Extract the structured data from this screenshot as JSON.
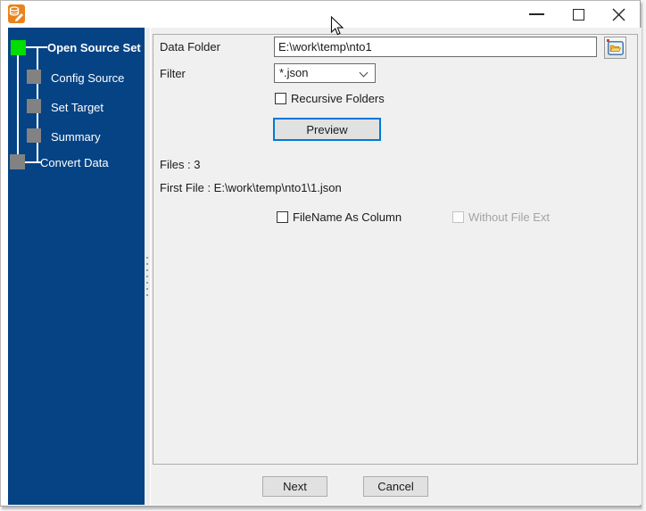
{
  "window": {
    "app_icon": "database-edit-icon",
    "controls": {
      "minimize": "minimize-icon",
      "maximize": "maximize-icon",
      "close": "close-icon"
    }
  },
  "sidebar": {
    "steps": [
      {
        "label": "Open Source Set",
        "state": "active"
      },
      {
        "label": "Config Source",
        "state": "pending"
      },
      {
        "label": "Set Target",
        "state": "pending"
      },
      {
        "label": "Summary",
        "state": "pending"
      },
      {
        "label": "Convert Data",
        "state": "pending"
      }
    ]
  },
  "form": {
    "data_folder_label": "Data Folder",
    "data_folder_value": "E:\\work\\temp\\nto1",
    "browse_icon": "folder-icon",
    "filter_label": "Filter",
    "filter_value": "*.json",
    "filter_dropdown_icon": "chevron-down-icon",
    "recursive_label": "Recursive Folders",
    "recursive_checked": false,
    "preview_label": "Preview",
    "files_text": "Files : 3",
    "first_file_text": "First File : E:\\work\\temp\\nto1\\1.json",
    "filename_as_column_label": "FileName As Column",
    "filename_as_column_checked": false,
    "without_file_ext_label": "Without File Ext",
    "without_file_ext_checked": false,
    "without_file_ext_disabled": true
  },
  "footer": {
    "next_label": "Next",
    "cancel_label": "Cancel"
  },
  "colors": {
    "sidebar_bg": "#064384",
    "active_step_square": "#00dd00",
    "pending_step_square": "#828282",
    "focus_border": "#0078d7",
    "panel_bg": "#f0f0f0",
    "button_bg": "#e1e1e1",
    "button_border": "#adadad",
    "disabled_text": "#a3a3a3"
  }
}
